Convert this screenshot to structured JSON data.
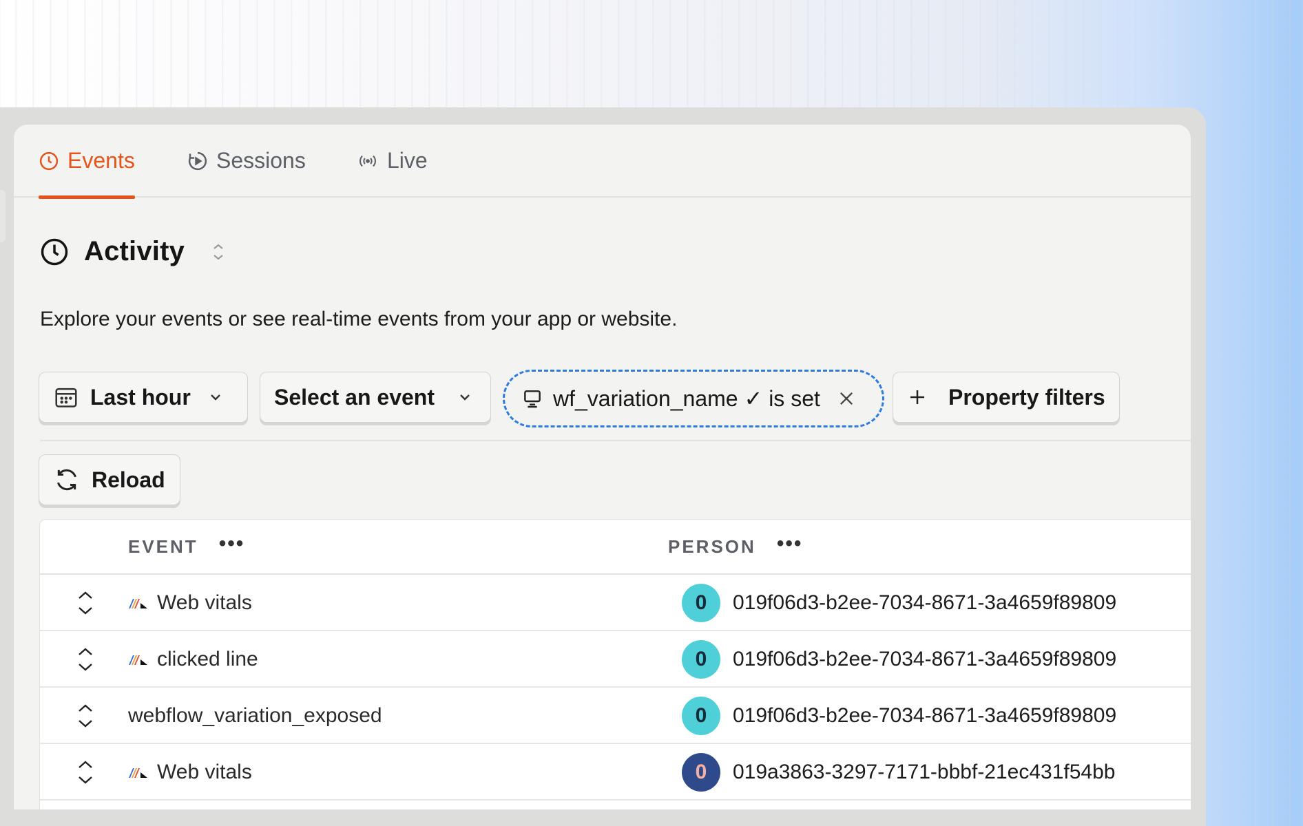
{
  "tabs": [
    {
      "label": "Events",
      "icon": "clock-icon",
      "active": true
    },
    {
      "label": "Sessions",
      "icon": "play-circle-icon",
      "active": false
    },
    {
      "label": "Live",
      "icon": "broadcast-icon",
      "active": false
    }
  ],
  "page": {
    "title": "Activity",
    "description": "Explore your events or see real-time events from your app or website."
  },
  "filters": {
    "date_range": "Last hour",
    "event_select": "Select an event",
    "active_filter": "wf_variation_name ✓ is set",
    "add_filter": "Property filters",
    "reload": "Reload"
  },
  "table": {
    "columns": [
      "EVENT",
      "PERSON"
    ],
    "column_menu": "•••",
    "rows": [
      {
        "event": "Web vitals",
        "has_icon": true,
        "person_initial": "0",
        "person_id": "019f06d3-b2ee-7034-8671-3a4659f89809",
        "avatar_color": "#4fd0d8",
        "avatar_text_color": "#1a2a3a"
      },
      {
        "event": "clicked line",
        "has_icon": true,
        "person_initial": "0",
        "person_id": "019f06d3-b2ee-7034-8671-3a4659f89809",
        "avatar_color": "#4fd0d8",
        "avatar_text_color": "#1a2a3a"
      },
      {
        "event": "webflow_variation_exposed",
        "has_icon": false,
        "person_initial": "0",
        "person_id": "019f06d3-b2ee-7034-8671-3a4659f89809",
        "avatar_color": "#4fd0d8",
        "avatar_text_color": "#1a2a3a"
      },
      {
        "event": "Web vitals",
        "has_icon": true,
        "person_initial": "0",
        "person_id": "019a3863-3297-7171-bbbf-21ec431f54bb",
        "avatar_color": "#2f4a8a",
        "avatar_text_color": "#f7b0a0"
      }
    ]
  },
  "colors": {
    "accent": "#e5541a",
    "filter_border": "#2c7be0"
  }
}
